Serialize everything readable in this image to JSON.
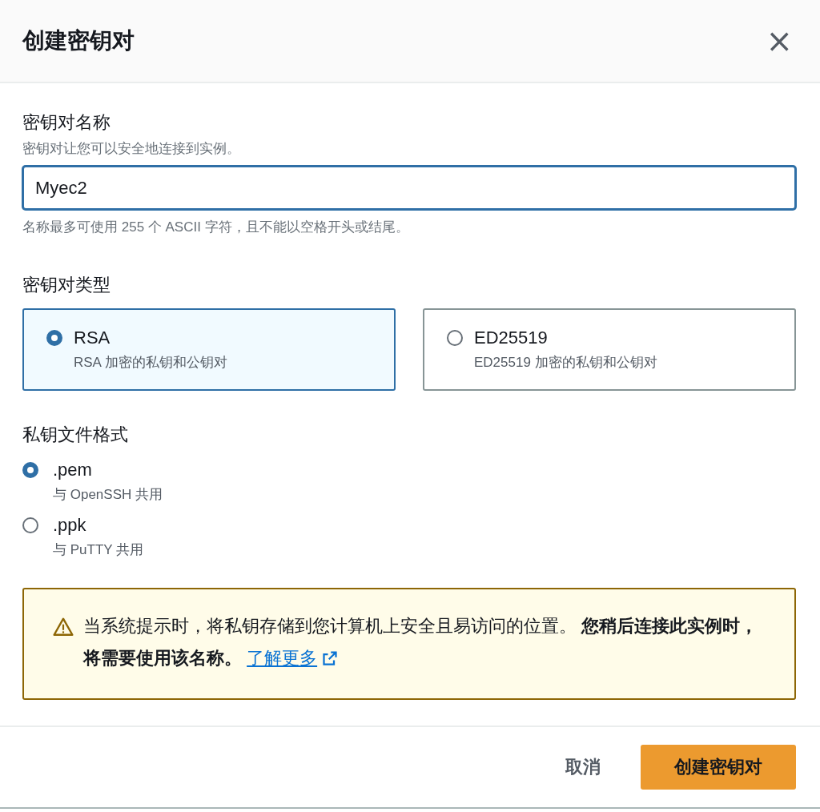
{
  "dialog": {
    "title": "创建密钥对",
    "close": "×"
  },
  "name_field": {
    "label": "密钥对名称",
    "description": "密钥对让您可以安全地连接到实例。",
    "value": "Myec2",
    "hint": "名称最多可使用 255 个 ASCII 字符，且不能以空格开头或结尾。"
  },
  "key_type": {
    "label": "密钥对类型",
    "options": [
      {
        "title": "RSA",
        "description": "RSA 加密的私钥和公钥对",
        "selected": true
      },
      {
        "title": "ED25519",
        "description": "ED25519 加密的私钥和公钥对",
        "selected": false
      }
    ]
  },
  "file_format": {
    "label": "私钥文件格式",
    "options": [
      {
        "title": ".pem",
        "description": "与 OpenSSH 共用",
        "selected": true
      },
      {
        "title": ".ppk",
        "description": "与 PuTTY 共用",
        "selected": false
      }
    ]
  },
  "alert": {
    "text": "当系统提示时，将私钥存储到您计算机上安全且易访问的位置。 **您稍后连接此实例时，将需要使用该名称。**",
    "link": "了解更多"
  },
  "buttons": {
    "cancel": "取消",
    "primary": "创建密钥对"
  }
}
